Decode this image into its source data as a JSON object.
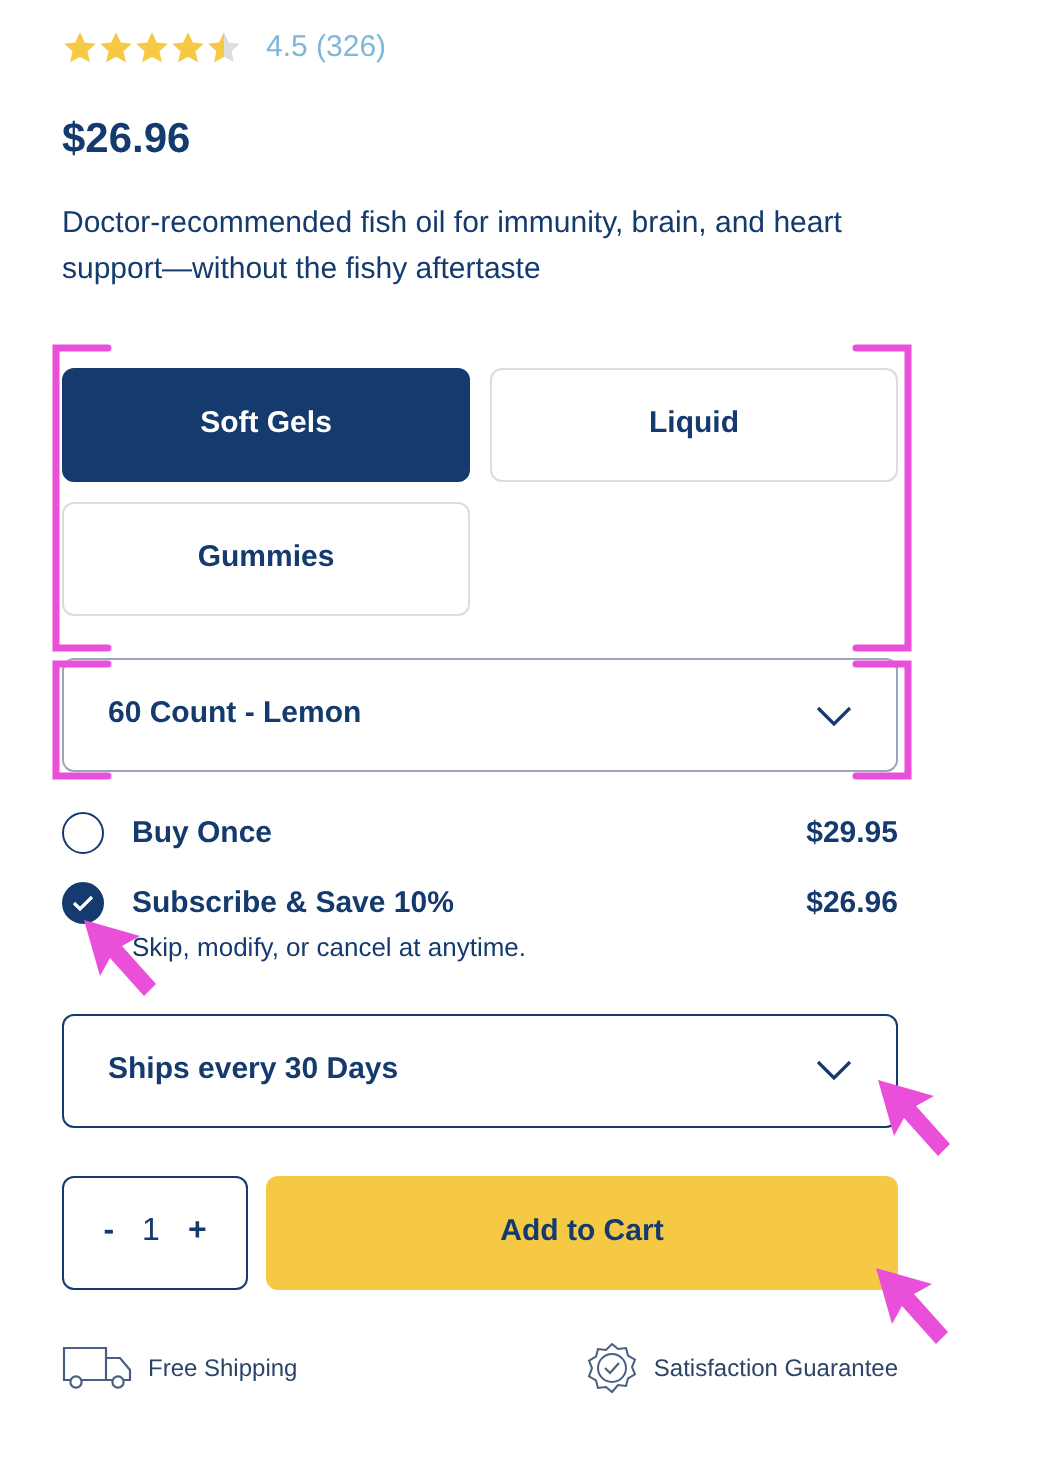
{
  "rating": {
    "stars": 4.5,
    "text": "4.5 (326)"
  },
  "price": "$26.96",
  "description": "Doctor-recommended fish oil for immunity, brain, and heart support—without the fishy aftertaste",
  "formats": [
    {
      "label": "Soft Gels",
      "selected": true
    },
    {
      "label": "Liquid",
      "selected": false
    },
    {
      "label": "Gummies",
      "selected": false
    }
  ],
  "size_select": {
    "value": "60 Count - Lemon"
  },
  "purchase_options": [
    {
      "label": "Buy Once",
      "price": "$29.95",
      "selected": false
    },
    {
      "label": "Subscribe & Save 10%",
      "price": "$26.96",
      "note": "Skip, modify, or cancel at anytime.",
      "selected": true
    }
  ],
  "frequency_select": {
    "value": "Ships every 30 Days"
  },
  "quantity": {
    "minus": "-",
    "value": "1",
    "plus": "+"
  },
  "add_to_cart": "Add to Cart",
  "perks": [
    {
      "kind": "shipping",
      "label": "Free Shipping"
    },
    {
      "kind": "guarantee",
      "label": "Satisfaction Guarantee"
    }
  ]
}
